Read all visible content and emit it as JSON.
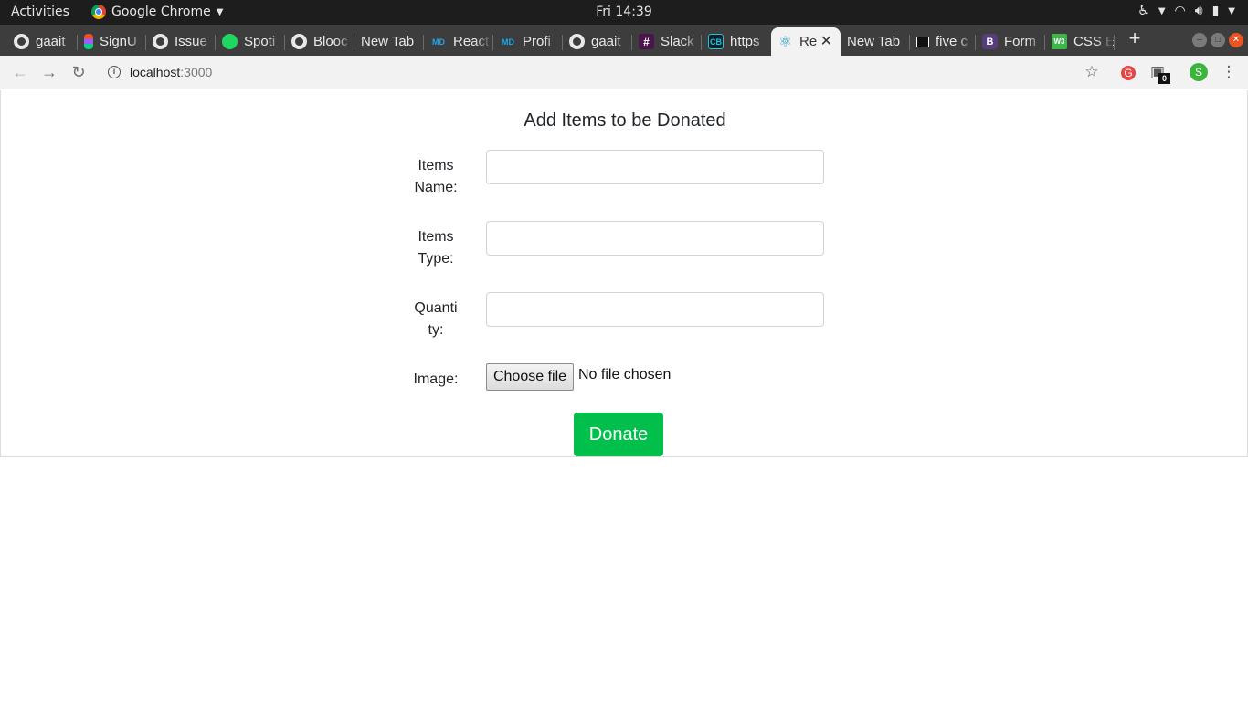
{
  "system_bar": {
    "activities": "Activities",
    "app_name": "Google Chrome",
    "clock": "Fri 14:39"
  },
  "tabs": [
    {
      "label": "gaait",
      "icon": "github-icon"
    },
    {
      "label": "SignU",
      "icon": "figma-icon"
    },
    {
      "label": "Issue",
      "icon": "github-icon"
    },
    {
      "label": "Spoti",
      "icon": "spotify-icon"
    },
    {
      "label": "Blooc",
      "icon": "github-icon"
    },
    {
      "label": "New Tab",
      "icon": ""
    },
    {
      "label": "React",
      "icon": "mdx-icon"
    },
    {
      "label": "Profi",
      "icon": "mdx-icon"
    },
    {
      "label": "gaait",
      "icon": "github-icon"
    },
    {
      "label": "Slack",
      "icon": "slack-icon"
    },
    {
      "label": "https",
      "icon": "codebox-icon"
    },
    {
      "label": "Re",
      "icon": "react-icon",
      "active": true
    },
    {
      "label": "New Tab",
      "icon": ""
    },
    {
      "label": "five c",
      "icon": "five-icon"
    },
    {
      "label": "Form",
      "icon": "bootstrap-icon"
    },
    {
      "label": "CSS E",
      "icon": "css-icon"
    }
  ],
  "toolbar": {
    "url_host": "localhost",
    "url_port": ":3000",
    "extension_badge": "0",
    "avatar_letter": "S"
  },
  "form": {
    "title": "Add Items to be Donated",
    "fields": [
      {
        "label_line1": "Items",
        "label_line2": "Name:",
        "value": ""
      },
      {
        "label_line1": "Items",
        "label_line2": "Type:",
        "value": ""
      },
      {
        "label_line1": "Quanti",
        "label_line2": "ty:",
        "value": ""
      }
    ],
    "image_label": "Image:",
    "file_button": "Choose file",
    "file_status": "No file chosen",
    "submit": "Donate"
  },
  "colors": {
    "donate_button": "#00c04b",
    "tab_strip": "#3d3d3d",
    "top_bar": "#1d1d1d"
  }
}
